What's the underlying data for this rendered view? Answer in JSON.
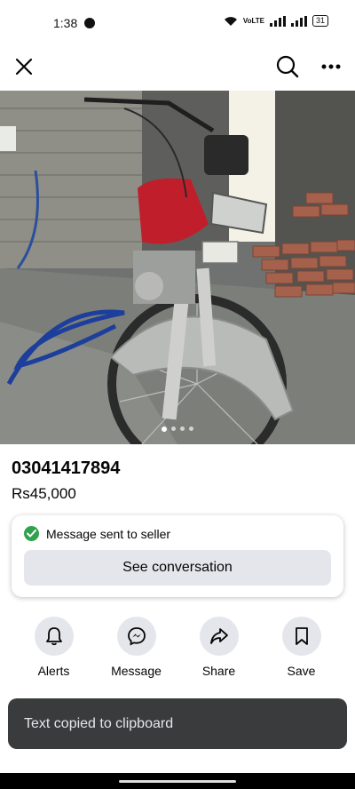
{
  "status_bar": {
    "time": "1:38",
    "network": "VoLTE",
    "battery": "31"
  },
  "listing": {
    "title": "03041417894",
    "price": "Rs45,000",
    "photo_count": 4,
    "current_photo": 1
  },
  "seller_card": {
    "sent_message": "Message sent to seller",
    "see_conversation": "See conversation"
  },
  "actions": [
    {
      "label": "Alerts",
      "icon": "bell-icon"
    },
    {
      "label": "Message",
      "icon": "messenger-icon"
    },
    {
      "label": "Share",
      "icon": "share-icon"
    },
    {
      "label": "Save",
      "icon": "bookmark-icon"
    }
  ],
  "toast": {
    "text": "Text copied to clipboard"
  },
  "colors": {
    "check_green": "#31a24c",
    "button_gray": "#e4e6eb",
    "toast_bg": "#3a3b3c"
  }
}
